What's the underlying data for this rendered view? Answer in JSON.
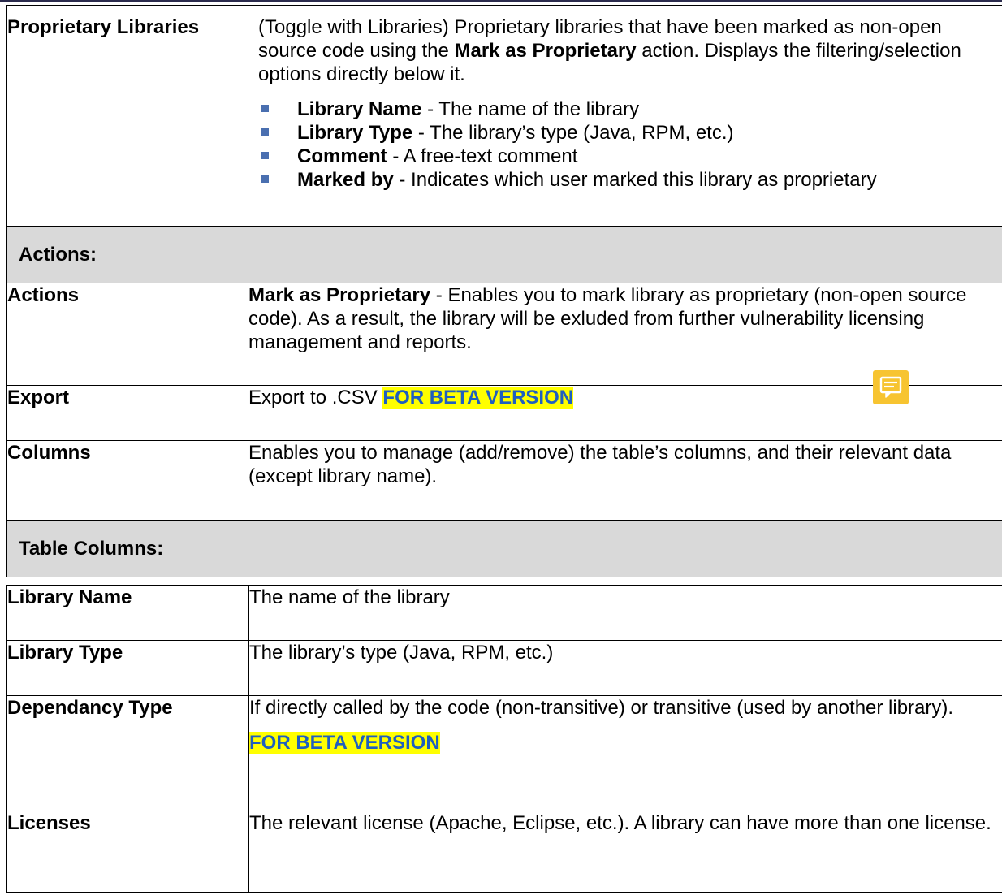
{
  "proprietary_row": {
    "label": "Proprietary Libraries",
    "intro_pre": "(Toggle with Libraries) Proprietary libraries that have been marked as non-open source code using the ",
    "intro_bold": "Mark as Proprietary",
    "intro_post": " action. Displays the filtering/selection options directly below it.",
    "bullets": [
      {
        "term": "Library Name",
        "text": " - The name of the library"
      },
      {
        "term": "Library Type",
        "text": " - The library’s type (Java, RPM, etc.)"
      },
      {
        "term": "Comment",
        "text": " - A free-text comment"
      },
      {
        "term": "Marked by",
        "text": " - Indicates which user marked this library as proprietary"
      }
    ]
  },
  "actions_section": {
    "heading": "Actions:",
    "rows": {
      "actions": {
        "label": "Actions",
        "bold": "Mark as Proprietary",
        "text": " - Enables you to mark library as proprietary (non-open source code). As a result, the library will be exluded from further vulnerability licensing management and reports."
      },
      "export": {
        "label": "Export",
        "text": "Export to .CSV ",
        "highlight": "FOR BETA VERSION"
      },
      "columns": {
        "label": "Columns",
        "text": "Enables you to manage (add/remove) the table’s columns, and their relevant data (except library name)."
      }
    }
  },
  "table_columns_section": {
    "heading": "Table Columns:",
    "rows": {
      "library_name": {
        "label": "Library Name",
        "text": "The name of the library"
      },
      "library_type": {
        "label": "Library Type",
        "text": "The library’s type (Java, RPM, etc.)"
      },
      "dependancy_type": {
        "label": "Dependancy Type",
        "text": "If directly called by the code (non-transitive) or transitive (used by another library).",
        "highlight": "FOR BETA VERSION"
      },
      "licenses": {
        "label": "Licenses",
        "text": "The relevant license (Apache, Eclipse, etc.). A library can have more than one license."
      }
    }
  },
  "icons": {
    "comment_note": "comment-note-icon"
  },
  "colors": {
    "highlight": "#ffff00",
    "highlight_text": "#1f5fbf",
    "section_bg": "#d9d9d9",
    "bullet": "#4a6fb0",
    "note_icon": "#f7c431"
  }
}
